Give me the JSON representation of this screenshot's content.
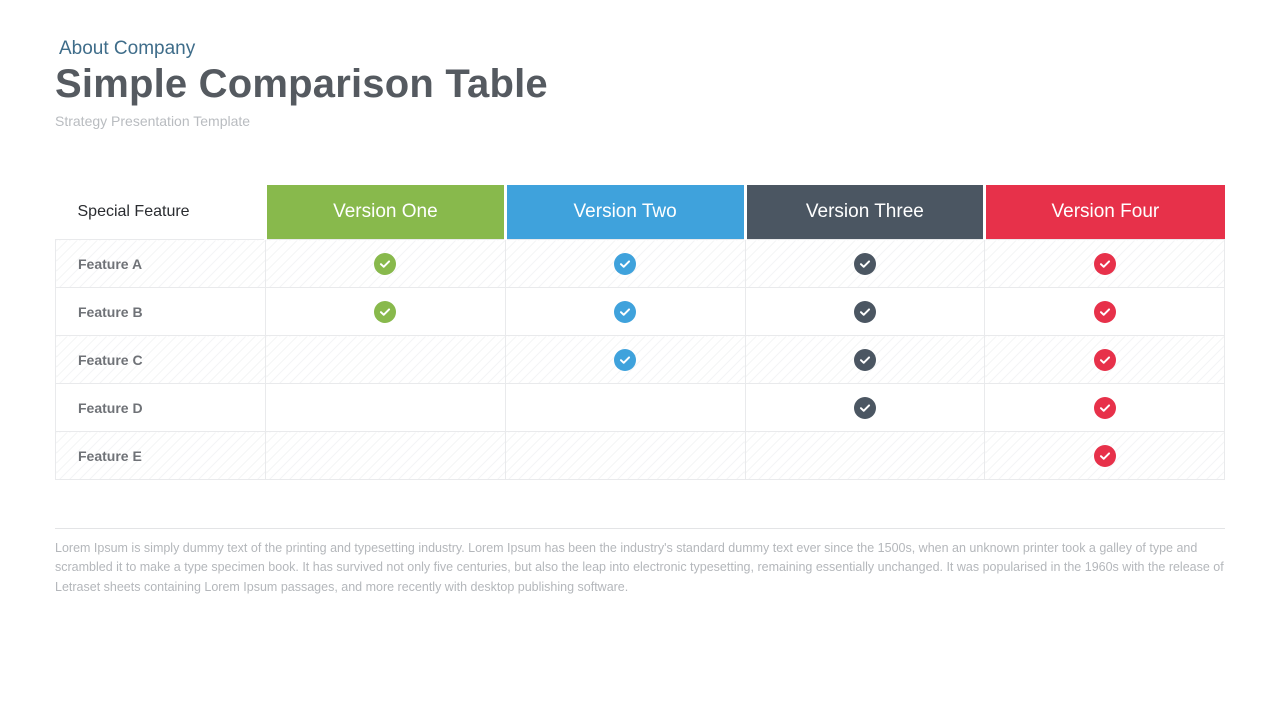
{
  "eyebrow": "About Company",
  "title": "Simple Comparison Table",
  "subtitle": "Strategy Presentation Template",
  "colors": {
    "green": "#88b94c",
    "blue": "#3fa2dc",
    "slate": "#4b5662",
    "red": "#e7314a"
  },
  "table": {
    "lead_header": "Special Feature",
    "columns": [
      {
        "label": "Version One",
        "color_key": "green"
      },
      {
        "label": "Version Two",
        "color_key": "blue"
      },
      {
        "label": "Version Three",
        "color_key": "slate"
      },
      {
        "label": "Version Four",
        "color_key": "red"
      }
    ],
    "rows": [
      {
        "label": "Feature A",
        "checks": [
          true,
          true,
          true,
          true
        ]
      },
      {
        "label": "Feature B",
        "checks": [
          true,
          true,
          true,
          true
        ]
      },
      {
        "label": "Feature C",
        "checks": [
          false,
          true,
          true,
          true
        ]
      },
      {
        "label": "Feature D",
        "checks": [
          false,
          false,
          true,
          true
        ]
      },
      {
        "label": "Feature E",
        "checks": [
          false,
          false,
          false,
          true
        ]
      }
    ]
  },
  "footnote": "Lorem Ipsum is simply dummy text of the printing and typesetting industry. Lorem Ipsum has been the industry's standard dummy text ever since the 1500s, when an unknown printer took a galley of type and scrambled it to make a type specimen book. It has survived not only five centuries, but also the leap into electronic typesetting, remaining essentially unchanged. It was popularised in the 1960s with the release of Letraset sheets containing Lorem Ipsum passages, and more recently with desktop publishing software."
}
